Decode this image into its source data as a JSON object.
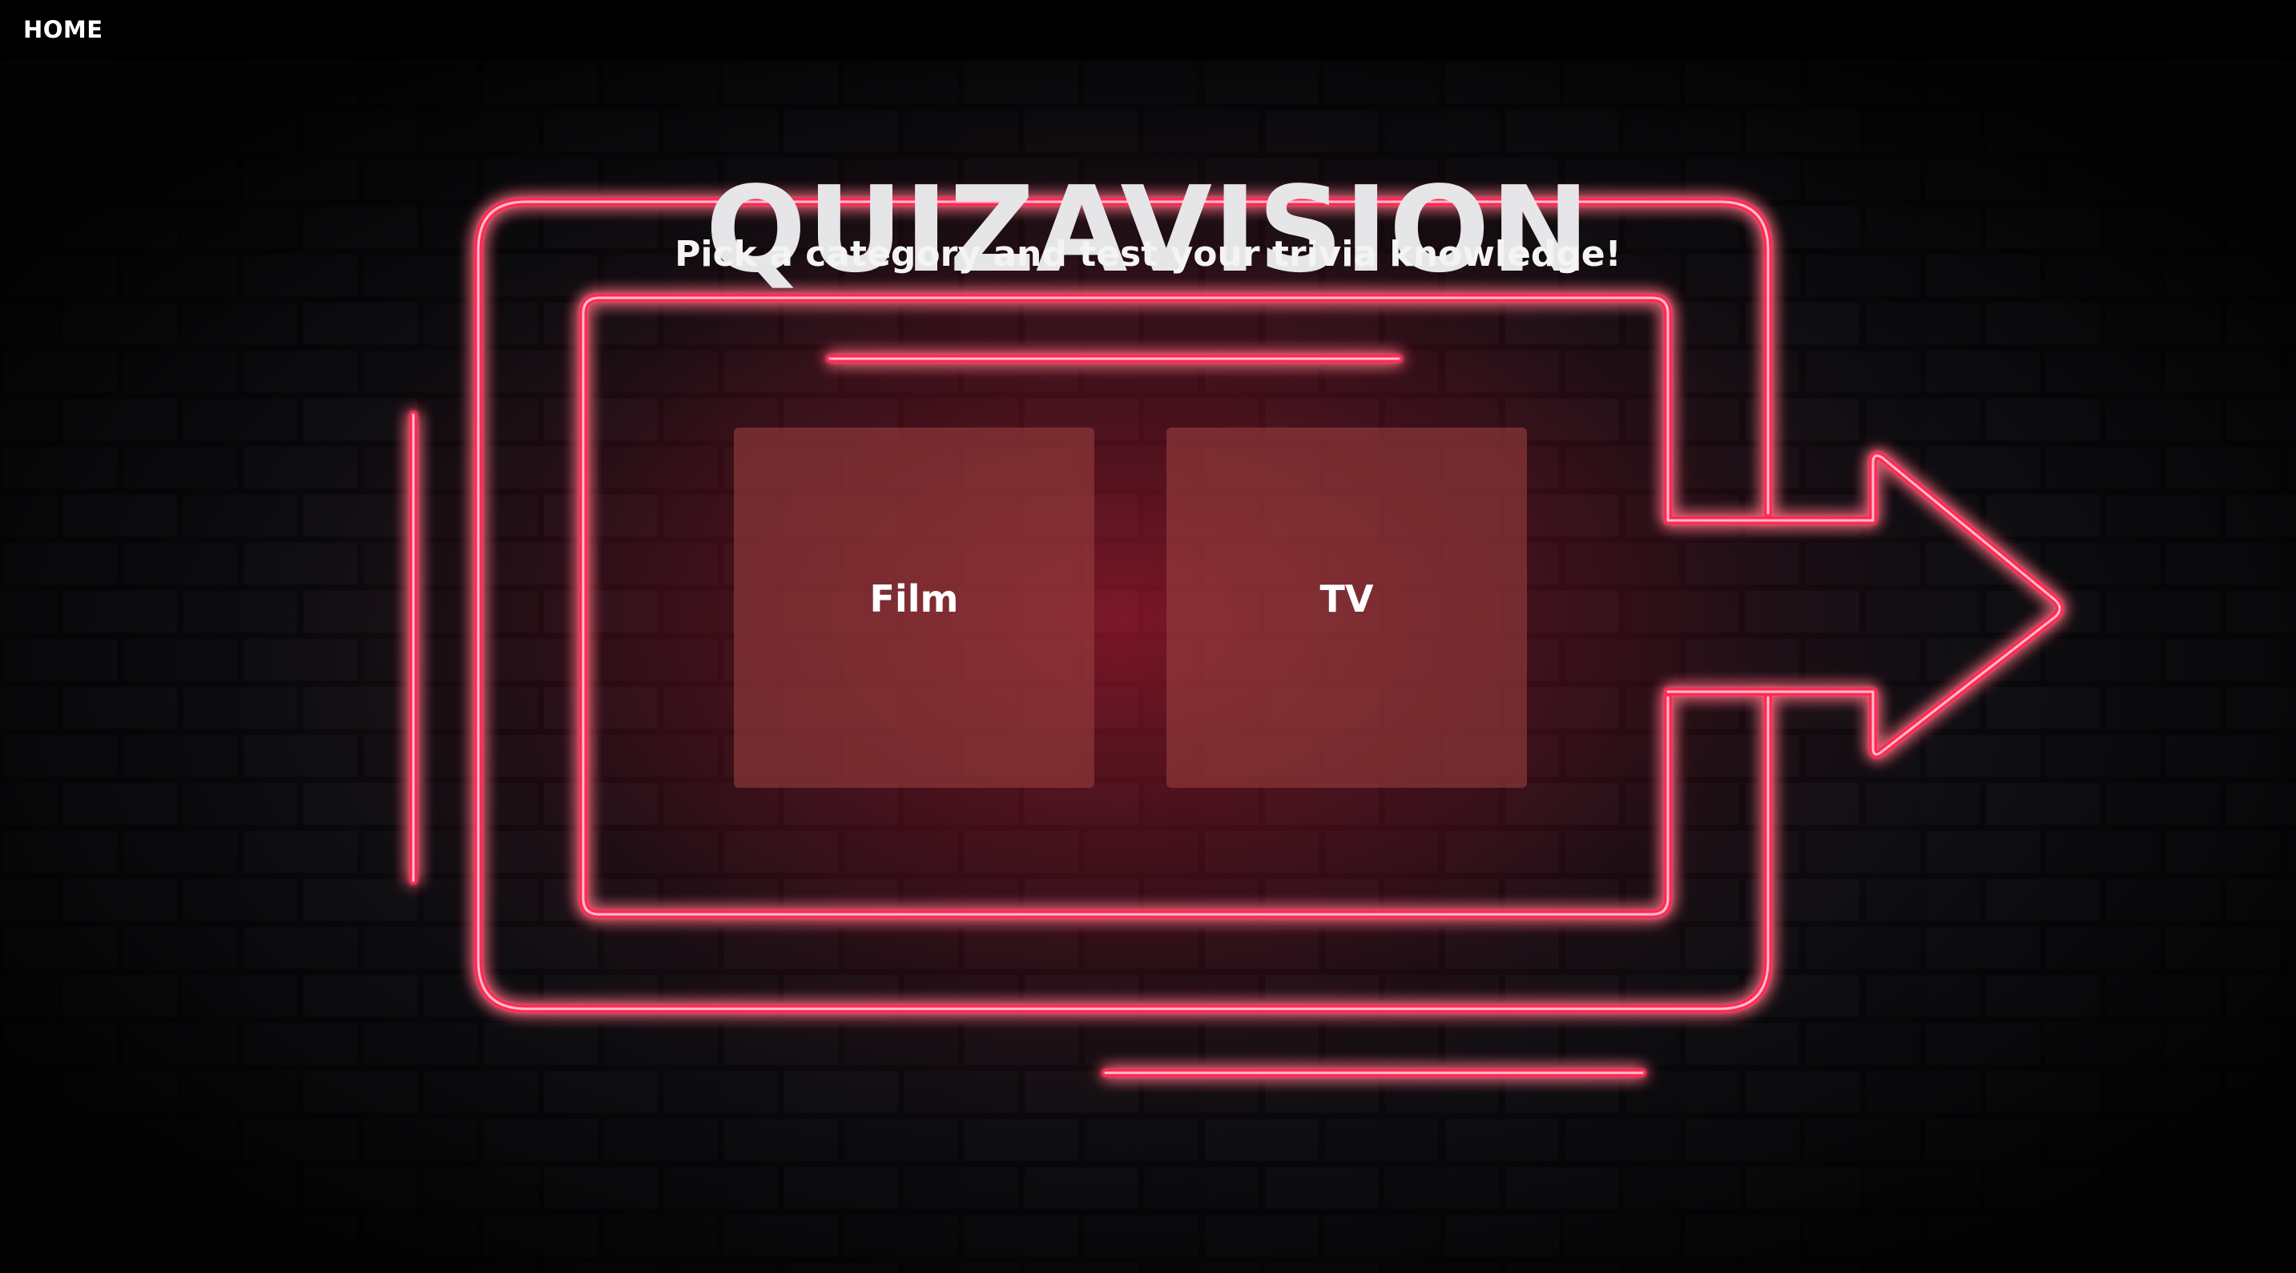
{
  "nav": {
    "home_label": "HOME"
  },
  "hero": {
    "title": "QUIZAVISION",
    "subtitle": "Pick a category and test your trivia knowledge!"
  },
  "categories": [
    {
      "label": "Film"
    },
    {
      "label": "TV"
    }
  ],
  "theme": {
    "background": "#000000",
    "neon_color": "#ff2a55",
    "card_color": "#963e3e",
    "text_color": "#ffffff",
    "neon_icon": "arrow-right-icon"
  }
}
